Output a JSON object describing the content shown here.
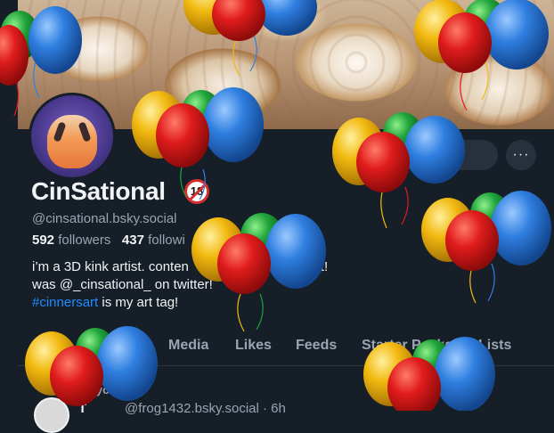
{
  "profile": {
    "display_name": "CinSational",
    "badge": "18",
    "handle": "@cinsational.bsky.social",
    "followers_count": "592",
    "followers_label": "followers",
    "following_count": "437",
    "following_label": "followi",
    "bio_line1": "i’m a 3D kink artist. conten",
    "bio_line1_end": "nd incest!",
    "bio_line2": "was @_cinsational_ on twitter!",
    "bio_tag": "#cinnersart",
    "bio_line3_rest": " is my art tag!",
    "edit_label": "rofile",
    "more_label": "···"
  },
  "tabs": [
    "Media",
    "Likes",
    "Feeds",
    "Starter Packs",
    "Lists"
  ],
  "feed": {
    "repost_label": "y you",
    "author": "T",
    "handle": "@frog1432.bsky.social · 6h"
  },
  "colors": {
    "background": "#161e27",
    "accent": "#208bfe",
    "muted": "#9aa5b1",
    "balloon_red": "#e01c1c",
    "balloon_blue": "#2f7fe0",
    "balloon_green": "#1fa33a",
    "balloon_yellow": "#f2b90f"
  },
  "overlay": "party-balloons"
}
